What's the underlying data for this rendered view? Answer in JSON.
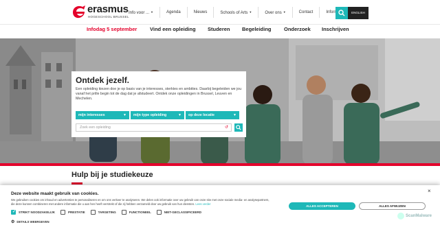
{
  "brand": {
    "name": "erasmus",
    "subtitle": "HOGESCHOOL BRUSSEL",
    "color": "#e4002b",
    "accent": "#1eb8b8"
  },
  "topnav": {
    "items": [
      "Info voor ...",
      "Agenda",
      "Nieuws",
      "Schools of Arts",
      "Over ons",
      "Contact",
      "Informeren"
    ],
    "language": "ENGLISH"
  },
  "mainnav": {
    "items": [
      "Infodag 5 september",
      "Vind een opleiding",
      "Studeren",
      "Begeleiding",
      "Onderzoek",
      "Inschrijven"
    ]
  },
  "hero": {
    "title": "Ontdek jezelf.",
    "text": "Een opleiding kiezen doe je op basis van je interesses, sterktes en ambities. Daarbij begeleiden we jou vanaf het prille begin tot de dag dat je afstudeert. Ontdek onze opleidingen in Brussel, Leuven en Mechelen.",
    "filters": [
      "mijn interesses",
      "mijn type opleiding",
      "op deze locatie"
    ],
    "search_placeholder": "Zoek een opleiding"
  },
  "section": {
    "title": "Hulp bij je studiekeuze"
  },
  "cookie": {
    "title": "Deze website maakt gebruik van cookies.",
    "text": "We gebruiken cookies om inhoud en advertenties te personaliseren en om ons verkeer te analyseren. We delen ook informatie over uw gebruik van onze site met onze sociale media- en analysepartners, die deze kunnen combineren met andere informatie die u aan hen heeft verstrekt of die zij hebben verzameld door uw gebruik van hun diensten.",
    "link": "Lees verder",
    "options": [
      {
        "label": "STRIKT NOODZAKELIJK",
        "checked": true
      },
      {
        "label": "PRESTATIE",
        "checked": false
      },
      {
        "label": "TARGETING",
        "checked": false
      },
      {
        "label": "FUNCTIONEEL",
        "checked": false
      },
      {
        "label": "NIET-GECLASSIFICEERD",
        "checked": false
      }
    ],
    "details": "DETAILS WEERGEVEN",
    "accept": "ALLES ACCEPTEREN",
    "reject": "ALLES AFWIJZEN",
    "close": "×"
  },
  "watermark": "ScanMalware"
}
